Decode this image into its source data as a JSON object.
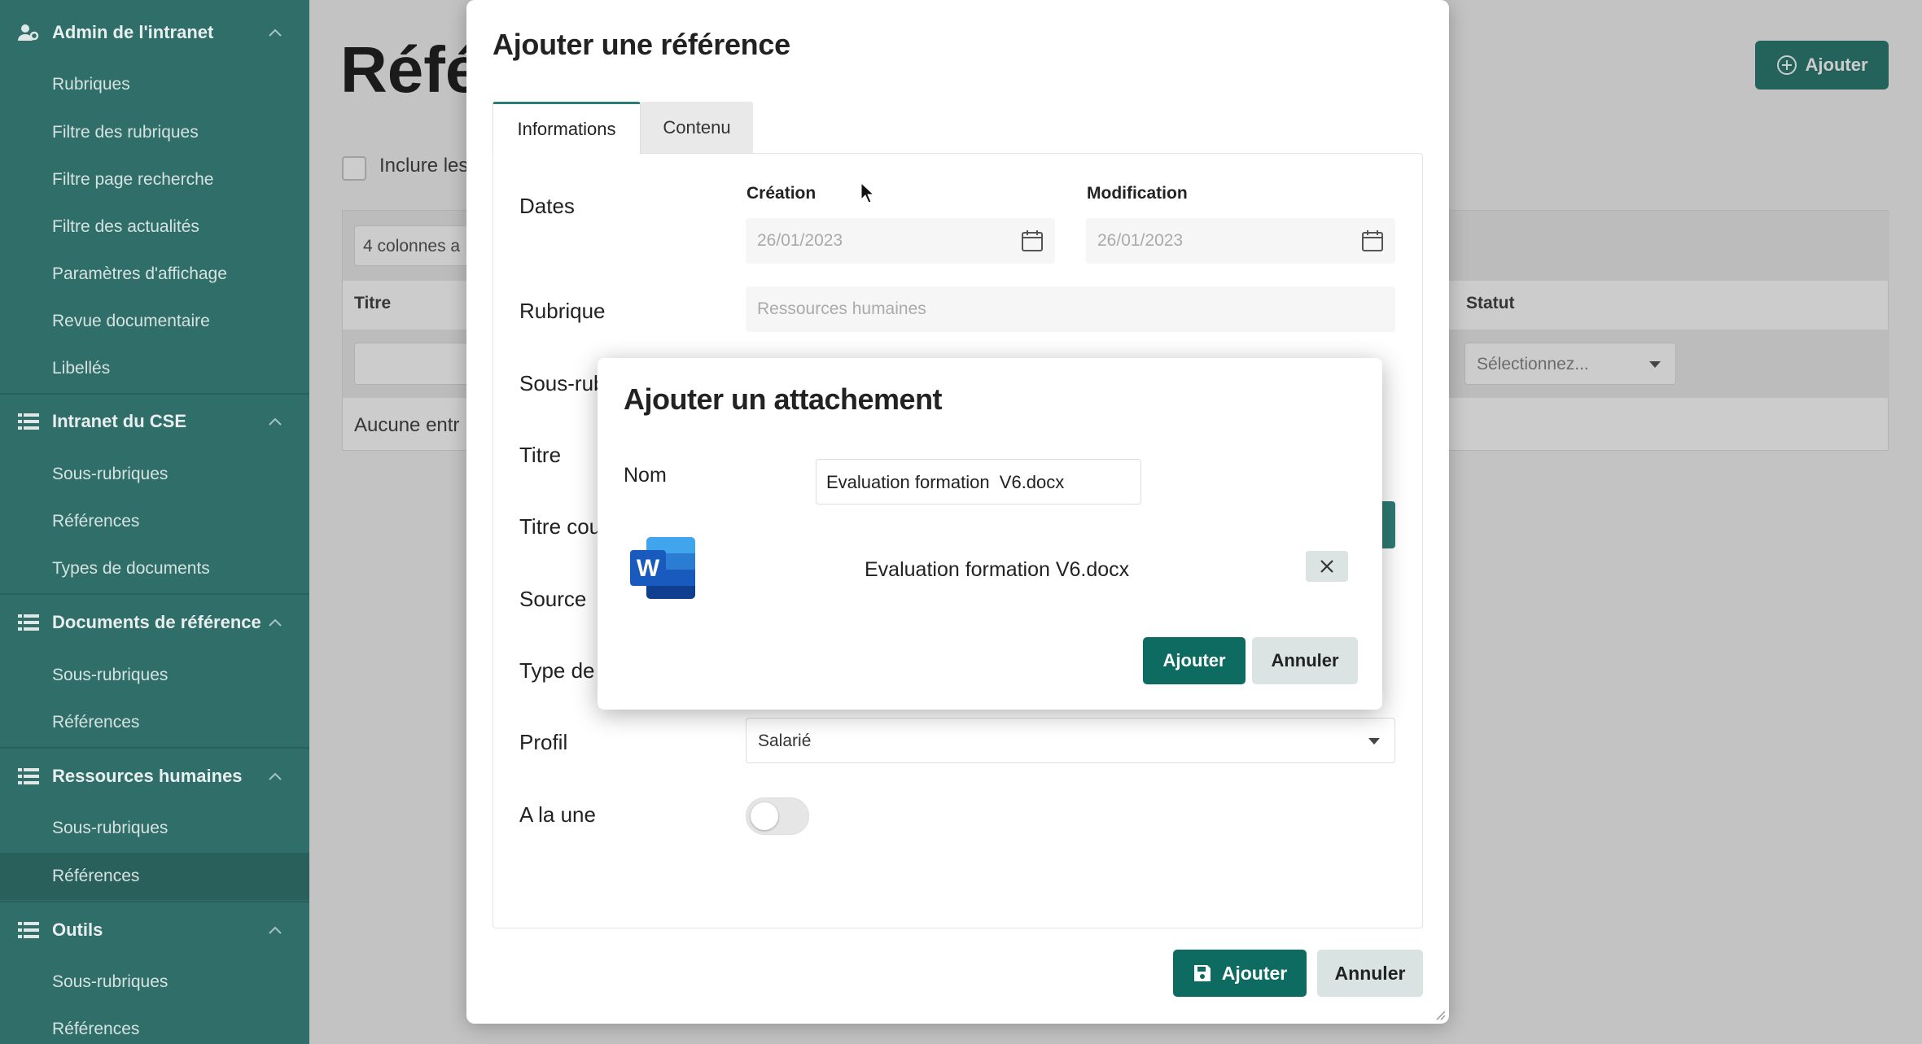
{
  "sidebar": {
    "groups": [
      {
        "title": "Admin de l'intranet",
        "icon": "user-gear-icon",
        "items": [
          "Rubriques",
          "Filtre des rubriques",
          "Filtre page recherche",
          "Filtre des actualités",
          "Paramètres d'affichage",
          "Revue documentaire",
          "Libellés"
        ]
      },
      {
        "title": "Intranet du CSE",
        "icon": "list-icon",
        "items": [
          "Sous-rubriques",
          "Références",
          "Types de documents"
        ]
      },
      {
        "title": "Documents de référence",
        "icon": "list-icon",
        "items": [
          "Sous-rubriques",
          "Références"
        ]
      },
      {
        "title": "Ressources humaines",
        "icon": "list-icon",
        "items": [
          "Sous-rubriques",
          "Références"
        ],
        "active_item": "Références"
      },
      {
        "title": "Outils",
        "icon": "list-icon",
        "items": [
          "Sous-rubriques",
          "Références"
        ]
      }
    ]
  },
  "background_page": {
    "title_visible": "Réfé",
    "add_button": "Ajouter",
    "include_label_visible": "Inclure les",
    "columns_label_visible": "4 colonnes a",
    "col_titre": "Titre",
    "col_statut": "Statut",
    "statut_placeholder": "Sélectionnez...",
    "empty_visible": "Aucune entr"
  },
  "main_modal": {
    "title": "Ajouter une référence",
    "tabs": [
      {
        "label": "Informations",
        "active": true
      },
      {
        "label": "Contenu",
        "active": false
      }
    ],
    "fields": {
      "dates_label": "Dates",
      "creation_label": "Création",
      "creation_value": "26/01/2023",
      "modification_label": "Modification",
      "modification_value": "26/01/2023",
      "rubrique_label": "Rubrique",
      "rubrique_placeholder": "Ressources humaines",
      "sous_rubrique_label_visible": "Sous-rub",
      "titre_label": "Titre",
      "titre_court_label_visible": "Titre cou",
      "source_label": "Source",
      "type_label_visible": "Type de",
      "profil_label": "Profil",
      "profil_value": "Salarié",
      "a_la_une_label": "A la une",
      "a_la_une_on": false
    },
    "save_button": "Ajouter",
    "cancel_button": "Annuler"
  },
  "attachment_modal": {
    "title": "Ajouter un attachement",
    "nom_label": "Nom",
    "nom_value": "Evaluation formation  V6.docx",
    "file_icon": "word-file-icon",
    "file_name": "Evaluation formation V6.docx",
    "add_button": "Ajouter",
    "cancel_button": "Annuler"
  },
  "colors": {
    "sidebar_bg": "#2f6e69",
    "primary": "#0e6b62",
    "secondary_btn": "#dbe4e3",
    "word_blue": "#185abd"
  }
}
